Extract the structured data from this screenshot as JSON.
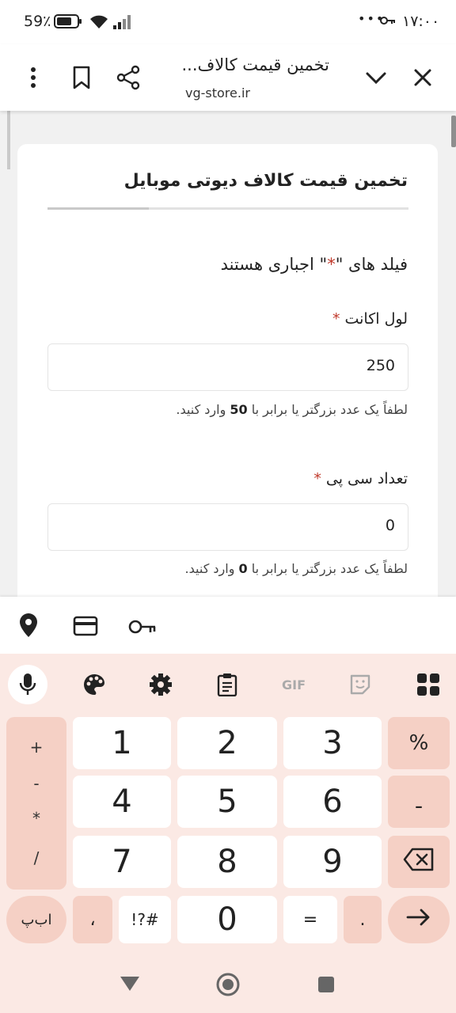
{
  "status_bar": {
    "time": "۱۷:۰۰",
    "dots": "•••",
    "battery": "59٪"
  },
  "browser": {
    "title": "تخمین قیمت کالاف...",
    "domain": "vg-store.ir"
  },
  "page": {
    "card_title": "تخمین قیمت کالاف دیوتی موبایل",
    "required_note_pre": "فیلد های \"",
    "required_note_star": "*",
    "required_note_post": "\" اجباری هستند",
    "fields": [
      {
        "label": "لول اکانت",
        "required_mark": "*",
        "value": "250",
        "help_pre": "لطفاً یک عدد بزرگتر یا برابر با ",
        "help_num": "50",
        "help_post": " وارد کنید."
      },
      {
        "label": "تعداد سی پی",
        "required_mark": "*",
        "value": "0",
        "help_pre": "لطفاً یک عدد بزرگتر یا برابر با ",
        "help_num": "0",
        "help_post": " وارد کنید."
      }
    ]
  },
  "keyboard": {
    "toolbar_gif": "GIF",
    "digits": [
      "1",
      "2",
      "3",
      "4",
      "5",
      "6",
      "7",
      "8",
      "9",
      "0"
    ],
    "right_keys": [
      "%",
      "ـ"
    ],
    "side_symbols": [
      "+",
      "-",
      "*",
      "/"
    ],
    "bottom": {
      "lang": "اب‌پ",
      "comma": "،",
      "symbols": "!?#",
      "equals": "=",
      "period": "."
    }
  },
  "colors": {
    "keyboard_bg": "#fbe9e4",
    "key_side": "#f5d0c5",
    "required_star": "#c0392b"
  }
}
